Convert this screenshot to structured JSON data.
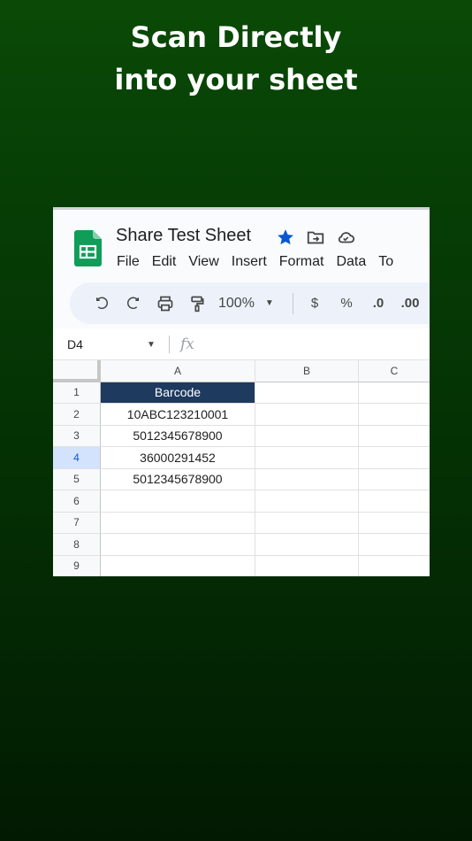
{
  "headline": {
    "line1": "Scan Directly",
    "line2": "into your sheet"
  },
  "app": {
    "title": "Share Test Sheet",
    "menu": [
      "File",
      "Edit",
      "View",
      "Insert",
      "Format",
      "Data",
      "To"
    ],
    "icons": [
      "star-icon",
      "move-to-folder-icon",
      "cloud-status-icon"
    ],
    "star_color": "#0b57d0",
    "logo_color": "#0f9d58"
  },
  "toolbar": {
    "zoom": "100%",
    "currency": "$",
    "percent": "%",
    "decrease_decimal": ".0",
    "increase_decimal": ".00"
  },
  "formula_bar": {
    "cell_ref": "D4",
    "fx_label": "fx"
  },
  "sheet": {
    "columns": [
      "A",
      "B",
      "C"
    ],
    "active_row": 4,
    "header_cell_color": "#1e3a5f",
    "rows": [
      {
        "num": "1",
        "A": "Barcode"
      },
      {
        "num": "2",
        "A": "10ABC123210001"
      },
      {
        "num": "3",
        "A": "5012345678900"
      },
      {
        "num": "4",
        "A": "36000291452"
      },
      {
        "num": "5",
        "A": "5012345678900"
      },
      {
        "num": "6",
        "A": ""
      },
      {
        "num": "7",
        "A": ""
      },
      {
        "num": "8",
        "A": ""
      },
      {
        "num": "9",
        "A": ""
      }
    ]
  }
}
